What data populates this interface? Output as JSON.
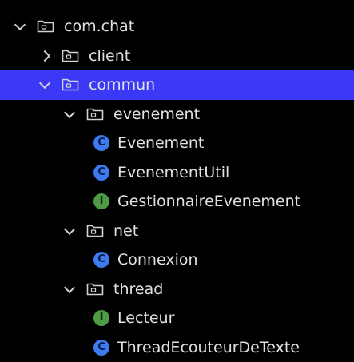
{
  "tree": {
    "nodes": [
      {
        "id": "com-chat",
        "label": "com.chat",
        "kind": "package",
        "depth": 0,
        "expanded": true,
        "selected": false
      },
      {
        "id": "client",
        "label": "client",
        "kind": "package",
        "depth": 1,
        "expanded": false,
        "selected": false
      },
      {
        "id": "commun",
        "label": "commun",
        "kind": "package",
        "depth": 1,
        "expanded": true,
        "selected": true
      },
      {
        "id": "evenement",
        "label": "evenement",
        "kind": "package",
        "depth": 2,
        "expanded": true,
        "selected": false
      },
      {
        "id": "Evenement",
        "label": "Evenement",
        "kind": "class",
        "depth": 3,
        "selected": false
      },
      {
        "id": "EvenementUtil",
        "label": "EvenementUtil",
        "kind": "class",
        "depth": 3,
        "selected": false
      },
      {
        "id": "GestionnaireEvenement",
        "label": "GestionnaireEvenement",
        "kind": "interface",
        "depth": 3,
        "selected": false
      },
      {
        "id": "net",
        "label": "net",
        "kind": "package",
        "depth": 2,
        "expanded": true,
        "selected": false
      },
      {
        "id": "Connexion",
        "label": "Connexion",
        "kind": "class",
        "depth": 3,
        "selected": false
      },
      {
        "id": "thread",
        "label": "thread",
        "kind": "package",
        "depth": 2,
        "expanded": true,
        "selected": false
      },
      {
        "id": "Lecteur",
        "label": "Lecteur",
        "kind": "interface",
        "depth": 3,
        "selected": false
      },
      {
        "id": "ThreadEcouteurDeTexte",
        "label": "ThreadEcouteurDeTexte",
        "kind": "class",
        "depth": 3,
        "selected": false
      }
    ]
  },
  "icons": {
    "class_glyph": "C",
    "interface_glyph": "I",
    "package_icon": "folder-package-icon",
    "expanded_icon": "chevron-down-icon",
    "collapsed_icon": "chevron-right-icon"
  },
  "colors": {
    "background": "#000000",
    "selection": "#3b39f5",
    "text": "#dfe1e5",
    "class_icon": "#3d7cf0",
    "interface_icon": "#4e9a46"
  }
}
